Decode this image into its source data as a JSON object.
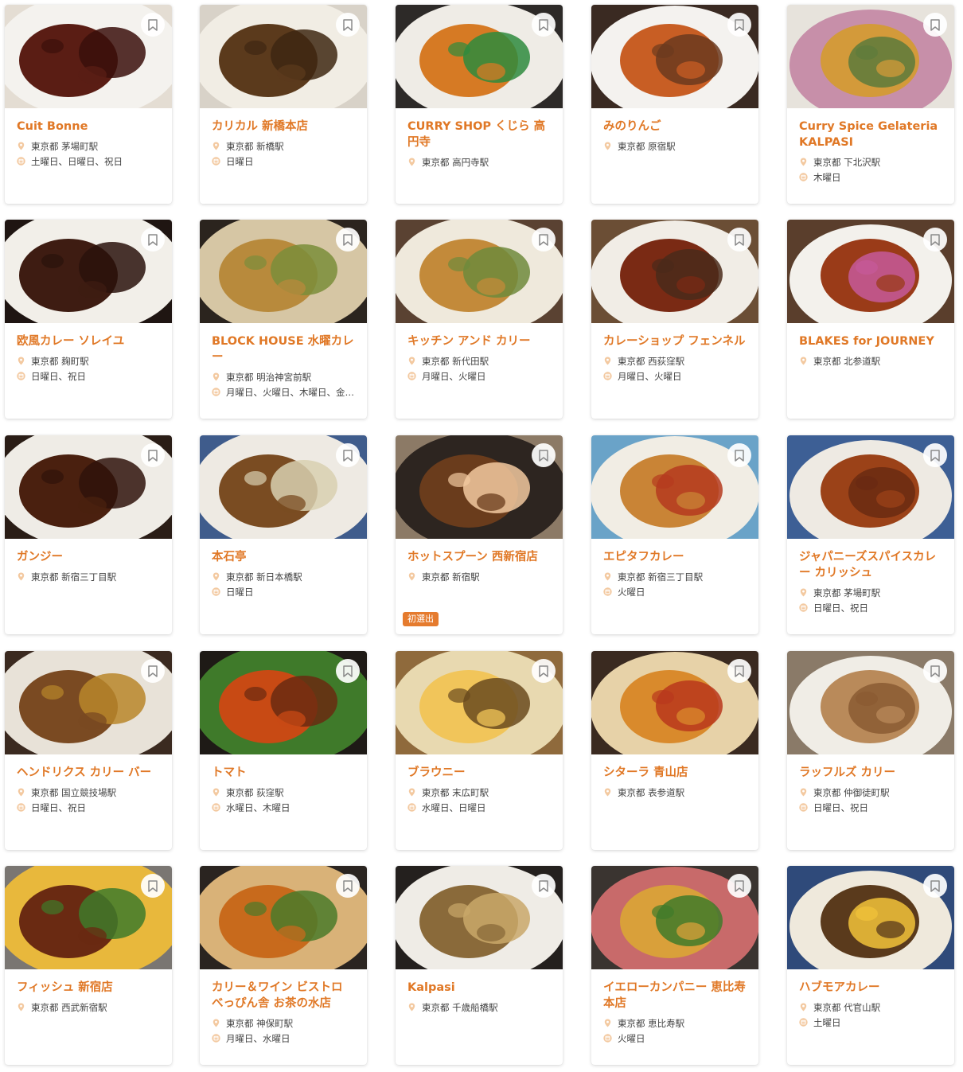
{
  "cards": [
    {
      "name": "Cuit Bonne",
      "station": "東京都 茅場町駅",
      "closed": "土曜日、日曜日、祝日",
      "badge": "",
      "palette": [
        "#e4ddd3",
        "#f4f2ee",
        "#5a1d14",
        "#3a0f0a"
      ]
    },
    {
      "name": "カリカル 新橋本店",
      "station": "東京都 新橋駅",
      "closed": "日曜日",
      "badge": "",
      "palette": [
        "#d8d2c8",
        "#f1ede4",
        "#5b3a1c",
        "#3e2712"
      ]
    },
    {
      "name": "CURRY SHOP くじら 高円寺",
      "station": "東京都 高円寺駅",
      "closed": "",
      "badge": "",
      "palette": [
        "#2d2a28",
        "#efece6",
        "#d67a24",
        "#2e8b3d"
      ]
    },
    {
      "name": "みのりんご",
      "station": "東京都 原宿駅",
      "closed": "",
      "badge": "",
      "palette": [
        "#3a2a22",
        "#f4f2ef",
        "#c85e24",
        "#6b3a1e"
      ]
    },
    {
      "name": "Curry Spice Gelateria KALPASI",
      "station": "東京都 下北沢駅",
      "closed": "木曜日",
      "badge": "",
      "palette": [
        "#e7e3dc",
        "#c78fa9",
        "#d39a3a",
        "#5c7a3c"
      ]
    },
    {
      "name": "欧風カレー ソレイユ",
      "station": "東京都 麹町駅",
      "closed": "日曜日、祝日",
      "badge": "",
      "palette": [
        "#1f1512",
        "#f2efe9",
        "#3e1c12",
        "#2a120c"
      ]
    },
    {
      "name": "BLOCK HOUSE 水曜カレー",
      "station": "東京都 明治神宮前駅",
      "closed": "月曜日、火曜日、木曜日、金曜日",
      "badge": "",
      "palette": [
        "#2b241e",
        "#d6c6a4",
        "#b88a3c",
        "#7a8d3a"
      ]
    },
    {
      "name": "キッチン アンド カリー",
      "station": "東京都 新代田駅",
      "closed": "月曜日、火曜日",
      "badge": "",
      "palette": [
        "#5a4232",
        "#efe9dc",
        "#c38a3a",
        "#6f8a3c"
      ]
    },
    {
      "name": "カレーショップ フェンネル",
      "station": "東京都 西荻窪駅",
      "closed": "月曜日、火曜日",
      "badge": "",
      "palette": [
        "#6b4e35",
        "#f1ede6",
        "#7a2a14",
        "#4a2a1a"
      ]
    },
    {
      "name": "BLAKES for JOURNEY",
      "station": "東京都 北参道駅",
      "closed": "",
      "badge": "",
      "palette": [
        "#5a3e2c",
        "#f3f1ec",
        "#9a3b18",
        "#c65a9a"
      ]
    },
    {
      "name": "ガンジー",
      "station": "東京都 新宿三丁目駅",
      "closed": "",
      "badge": "",
      "palette": [
        "#2a1d16",
        "#efece6",
        "#4a200f",
        "#2f130a"
      ]
    },
    {
      "name": "本石亭",
      "station": "東京都 新日本橋駅",
      "closed": "日曜日",
      "badge": "",
      "palette": [
        "#3f5c8c",
        "#eeeae3",
        "#7a4c22",
        "#d8d0b0"
      ]
    },
    {
      "name": "ホットスプーン 西新宿店",
      "station": "東京都 新宿駅",
      "closed": "",
      "badge": "初選出",
      "palette": [
        "#8c7a66",
        "#2d2520",
        "#6a3c1c",
        "#f2c9a0"
      ]
    },
    {
      "name": "エピタフカレー",
      "station": "東京都 新宿三丁目駅",
      "closed": "火曜日",
      "badge": "",
      "palette": [
        "#6aa3c8",
        "#f1ede4",
        "#c98436",
        "#b53a1e"
      ]
    },
    {
      "name": "ジャパニーズスパイスカレー カリッシュ",
      "station": "東京都 茅場町駅",
      "closed": "日曜日、祝日",
      "badge": "",
      "palette": [
        "#3d5f95",
        "#eeeae3",
        "#9b4218",
        "#6a2a12"
      ]
    },
    {
      "name": "ヘンドリクス カリー バー",
      "station": "東京都 国立競技場駅",
      "closed": "日曜日、祝日",
      "badge": "",
      "palette": [
        "#3b2a20",
        "#e8e2d8",
        "#7a4a22",
        "#b8862a"
      ]
    },
    {
      "name": "トマト",
      "station": "東京都 荻窪駅",
      "closed": "水曜日、木曜日",
      "badge": "",
      "palette": [
        "#1e1a16",
        "#3f7a2a",
        "#c84a14",
        "#6a2a10"
      ]
    },
    {
      "name": "ブラウニー",
      "station": "東京都 末広町駅",
      "closed": "水曜日、日曜日",
      "badge": "",
      "palette": [
        "#8f6a3c",
        "#e8d9b0",
        "#f1c55a",
        "#6a4a1e"
      ]
    },
    {
      "name": "シターラ 青山店",
      "station": "東京都 表参道駅",
      "closed": "",
      "badge": "",
      "palette": [
        "#3a2a20",
        "#e7d2a8",
        "#d98a2c",
        "#b8371c"
      ]
    },
    {
      "name": "ラッフルズ カリー",
      "station": "東京都 仲御徒町駅",
      "closed": "日曜日、祝日",
      "badge": "",
      "palette": [
        "#8a7a68",
        "#f0ede6",
        "#b98a5a",
        "#8a5a32"
      ]
    },
    {
      "name": "フィッシュ 新宿店",
      "station": "東京都 西武新宿駅",
      "closed": "",
      "badge": "",
      "palette": [
        "#7a7672",
        "#e8b83c",
        "#6a2a12",
        "#3e7a2a"
      ]
    },
    {
      "name": "カリー＆ワイン ビストロ べっぴん舎 お茶の水店",
      "station": "東京都 神保町駅",
      "closed": "月曜日、水曜日",
      "badge": "",
      "palette": [
        "#2a2420",
        "#d9b278",
        "#c86a1c",
        "#4a7a2a"
      ]
    },
    {
      "name": "Kalpasi",
      "station": "東京都 千歳船橋駅",
      "closed": "",
      "badge": "",
      "palette": [
        "#24201e",
        "#efece6",
        "#8a6a3a",
        "#c9a86a"
      ]
    },
    {
      "name": "イエローカンパニー 恵比寿本店",
      "station": "東京都 恵比寿駅",
      "closed": "火曜日",
      "badge": "",
      "palette": [
        "#3a3430",
        "#c86a6a",
        "#d9a03a",
        "#3f7a2a"
      ]
    },
    {
      "name": "ハブモアカレー",
      "station": "東京都 代官山駅",
      "closed": "土曜日",
      "badge": "",
      "palette": [
        "#2f4a7a",
        "#efe9dc",
        "#5a3a1c",
        "#f2c33a"
      ]
    }
  ],
  "icons": {
    "pin": "map-pin-icon",
    "closed": "closed-day-icon",
    "bookmark": "bookmark-icon"
  },
  "colors": {
    "accent": "#e07826",
    "icon": "#f3c9a0"
  }
}
